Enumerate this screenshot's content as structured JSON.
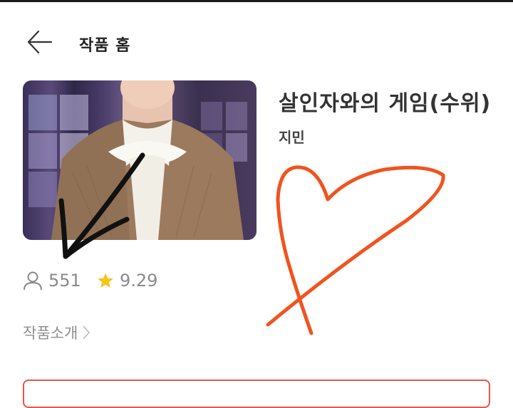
{
  "header": {
    "back_icon": "arrow-left-icon",
    "title": "작품 홈"
  },
  "work": {
    "title": "살인자와의 게임(수위)",
    "author": "지민",
    "cover_image": "photo of a person in a brown knit cardigan with a white neck bow",
    "views": "551",
    "views_icon": "person-icon",
    "rating": "9.29",
    "rating_icon": "star-icon"
  },
  "intro": {
    "label": "작품소개",
    "chevron_icon": "chevron-right-icon"
  },
  "colors": {
    "accent": "#e8554a",
    "star": "#f5c518",
    "annotation_heart": "#f0541e",
    "annotation_arrow": "#111111"
  }
}
